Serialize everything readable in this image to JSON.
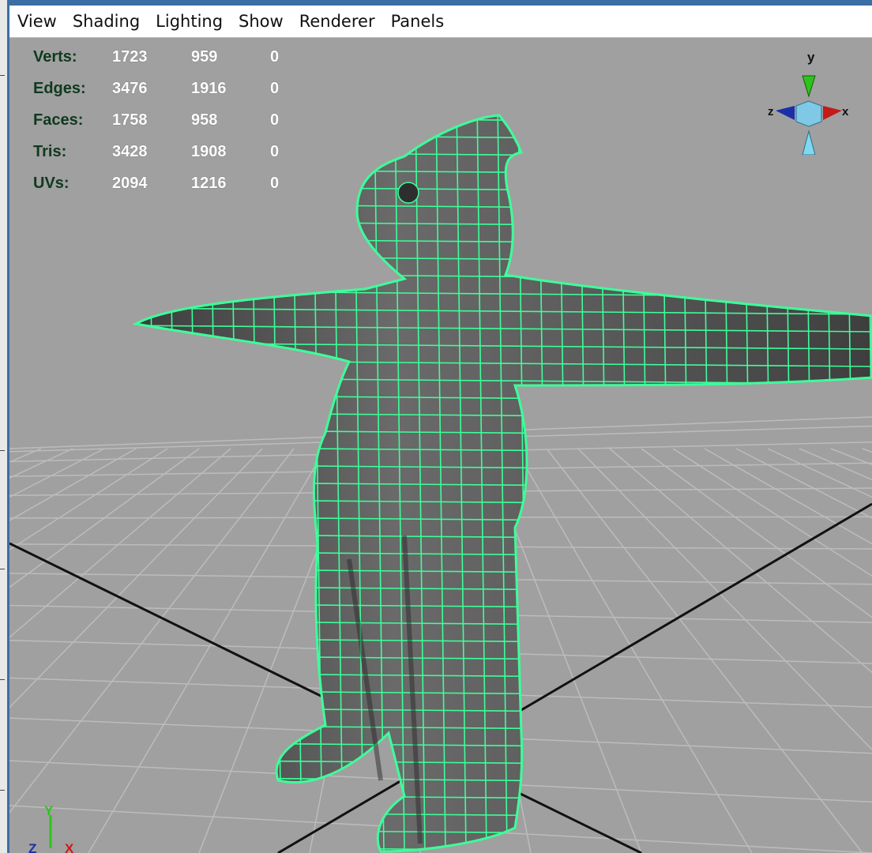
{
  "menubar": {
    "items": [
      "View",
      "Shading",
      "Lighting",
      "Show",
      "Renderer",
      "Panels"
    ]
  },
  "hud": {
    "rows": [
      {
        "label": "Verts:",
        "v1": "1723",
        "v2": "959",
        "v3": "0"
      },
      {
        "label": "Edges:",
        "v1": "3476",
        "v2": "1916",
        "v3": "0"
      },
      {
        "label": "Faces:",
        "v1": "1758",
        "v2": "958",
        "v3": "0"
      },
      {
        "label": "Tris:",
        "v1": "3428",
        "v2": "1908",
        "v3": "0"
      },
      {
        "label": "UVs:",
        "v1": "2094",
        "v2": "1216",
        "v3": "0"
      }
    ]
  },
  "view_cube": {
    "y": "y",
    "x": "x",
    "z": "z"
  },
  "axis_triad": {
    "y": "Y",
    "z": "Z",
    "x": "X"
  },
  "colors": {
    "viewport_bg": "#a0a0a0",
    "wireframe": "#3dff9a",
    "mesh_fill": "#585858",
    "grid": "#bcbcbc",
    "hud_label": "#0f3a1e",
    "hud_value": "#ffffff"
  },
  "icons": [
    "view-cube-icon",
    "axis-triad-icon"
  ]
}
